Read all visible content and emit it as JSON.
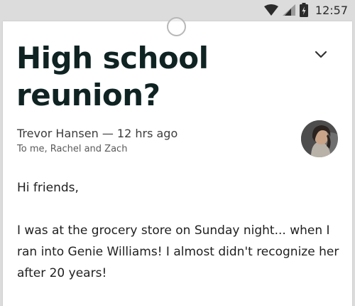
{
  "status_bar": {
    "time": "12:57",
    "icons": [
      "wifi-icon",
      "cellular-signal-icon",
      "battery-icon"
    ]
  },
  "email": {
    "subject": "High school reunion?",
    "sender": "Trevor Hansen",
    "separator": "—",
    "time_ago": "12 hrs ago",
    "recipients": "To me, Rachel and Zach",
    "greeting": "Hi friends,",
    "paragraph": "I was at the grocery store on Sunday night... when I ran into Genie Williams! I almost didn't recognize her after 20 years!"
  },
  "colors": {
    "title": "#102323",
    "background": "#ffffff",
    "status_bar": "#dcdcdc"
  }
}
